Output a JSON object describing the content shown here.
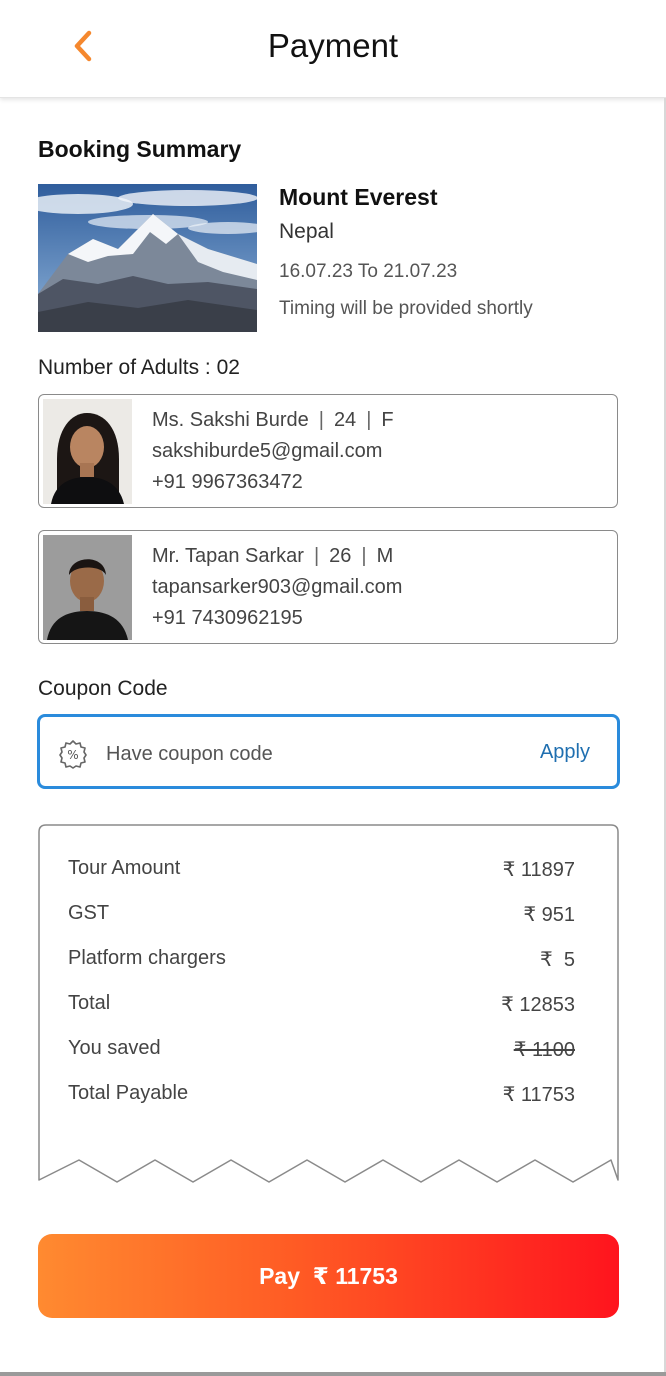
{
  "header": {
    "title": "Payment",
    "back_icon": "chevron-left-icon",
    "accent": "#f5882e"
  },
  "summary": {
    "section_title": "Booking Summary",
    "trip_name": "Mount Everest",
    "country": "Nepal",
    "dates": "16.07.23 To 21.07.23",
    "timing": "Timing will be provided shortly"
  },
  "adults": {
    "label": "Number of Adults : 02",
    "list": [
      {
        "name": "Ms. Sakshi Burde",
        "age": "24",
        "gender": "F",
        "email": "sakshiburde5@gmail.com",
        "phone": "+91 9967363472"
      },
      {
        "name": "Mr. Tapan Sarkar",
        "age": "26",
        "gender": "M",
        "email": "tapansarker903@gmail.com",
        "phone": "+91 7430962195"
      }
    ]
  },
  "coupon": {
    "label": "Coupon Code",
    "placeholder": "Have coupon code",
    "apply_label": "Apply",
    "icon": "discount-badge-icon",
    "border_color": "#2a8bdc"
  },
  "bill": {
    "rows": [
      {
        "label": "Tour Amount",
        "value": "₹ 11897"
      },
      {
        "label": "GST",
        "value": "₹ 951"
      },
      {
        "label": "Platform chargers",
        "value": "₹  5"
      },
      {
        "label": "Total",
        "value": "₹ 12853"
      },
      {
        "label": "You saved",
        "value": "₹ 1100",
        "strikethrough": true
      },
      {
        "label": "Total Payable",
        "value": "₹ 11753"
      }
    ]
  },
  "pay_button": {
    "label": "Pay  ₹ 11753",
    "gradient_start": "#ff8a30",
    "gradient_end": "#ff141e"
  }
}
